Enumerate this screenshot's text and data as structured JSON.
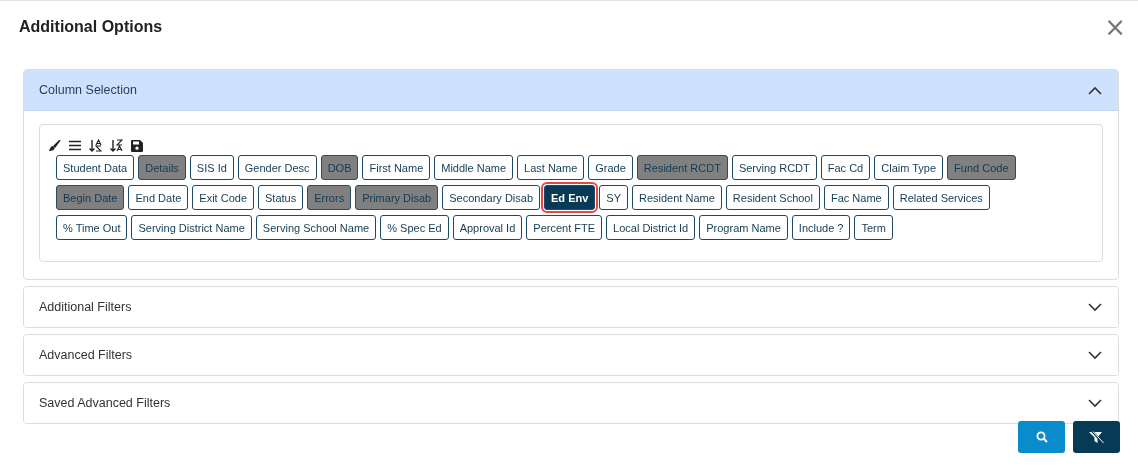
{
  "dialog": {
    "title": "Additional Options",
    "close": "×"
  },
  "sections": [
    {
      "title": "Column Selection",
      "expanded": true,
      "chip_rows": [
        [
          {
            "label": "Student Data",
            "selected": false,
            "focused": false
          },
          {
            "label": "Details",
            "selected": true,
            "focused": false
          },
          {
            "label": "SIS Id",
            "selected": false,
            "focused": false
          },
          {
            "label": "Gender Desc",
            "selected": false,
            "focused": false
          },
          {
            "label": "DOB",
            "selected": true,
            "focused": false
          },
          {
            "label": "First Name",
            "selected": false,
            "focused": false
          },
          {
            "label": "Middle Name",
            "selected": false,
            "focused": false
          },
          {
            "label": "Last Name",
            "selected": false,
            "focused": false
          },
          {
            "label": "Grade",
            "selected": false,
            "focused": false
          },
          {
            "label": "Resident RCDT",
            "selected": true,
            "focused": false
          },
          {
            "label": "Serving RCDT",
            "selected": false,
            "focused": false
          },
          {
            "label": "Fac Cd",
            "selected": false,
            "focused": false
          },
          {
            "label": "Claim Type",
            "selected": false,
            "focused": false
          },
          {
            "label": "Fund Code",
            "selected": true,
            "focused": false
          }
        ],
        [
          {
            "label": "Begin Date",
            "selected": true,
            "focused": false
          },
          {
            "label": "End Date",
            "selected": false,
            "focused": false
          },
          {
            "label": "Exit Code",
            "selected": false,
            "focused": false
          },
          {
            "label": "Status",
            "selected": false,
            "focused": false
          },
          {
            "label": "Errors",
            "selected": true,
            "focused": false
          },
          {
            "label": "Primary Disab",
            "selected": true,
            "focused": false
          },
          {
            "label": "Secondary Disab",
            "selected": false,
            "focused": false
          },
          {
            "label": "Ed Env",
            "selected": false,
            "focused": true
          },
          {
            "label": "SY",
            "selected": false,
            "focused": false
          },
          {
            "label": "Resident Name",
            "selected": false,
            "focused": false
          },
          {
            "label": "Resident School",
            "selected": false,
            "focused": false
          },
          {
            "label": "Fac Name",
            "selected": false,
            "focused": false
          },
          {
            "label": "Related Services",
            "selected": false,
            "focused": false
          }
        ],
        [
          {
            "label": "% Time Out",
            "selected": false,
            "focused": false
          },
          {
            "label": "Serving District Name",
            "selected": false,
            "focused": false
          },
          {
            "label": "Serving School Name",
            "selected": false,
            "focused": false
          },
          {
            "label": "% Spec Ed",
            "selected": false,
            "focused": false
          },
          {
            "label": "Approval Id",
            "selected": false,
            "focused": false
          },
          {
            "label": "Percent FTE",
            "selected": false,
            "focused": false
          },
          {
            "label": "Local District Id",
            "selected": false,
            "focused": false
          },
          {
            "label": "Program Name",
            "selected": false,
            "focused": false
          },
          {
            "label": "Include ?",
            "selected": false,
            "focused": false
          },
          {
            "label": "Term",
            "selected": false,
            "focused": false
          }
        ]
      ]
    },
    {
      "title": "Additional Filters",
      "expanded": false
    },
    {
      "title": "Advanced Filters",
      "expanded": false
    },
    {
      "title": "Saved Advanced Filters",
      "expanded": false
    }
  ]
}
